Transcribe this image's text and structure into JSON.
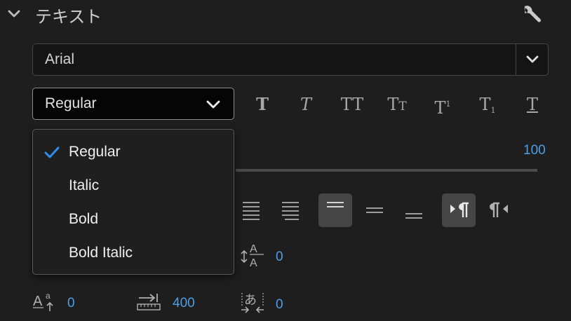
{
  "panel": {
    "title": "テキスト"
  },
  "font_family": {
    "value": "Arial"
  },
  "font_style": {
    "value": "Regular",
    "options": [
      {
        "label": "Regular",
        "checked": true
      },
      {
        "label": "Italic",
        "checked": false
      },
      {
        "label": "Bold",
        "checked": false
      },
      {
        "label": "Bold Italic",
        "checked": false
      }
    ]
  },
  "style_buttons": {
    "bold": "T",
    "italic": "T",
    "all_caps": "TT",
    "small_caps": "TT",
    "superscript": "T",
    "subscript": "T",
    "underline": "T"
  },
  "values": {
    "font_size": "100",
    "leading": "0",
    "baseline_shift": "0",
    "tab_width": "400",
    "tsume": "0"
  },
  "colors": {
    "accent": "#4d9fe8",
    "check": "#2f8df0"
  }
}
